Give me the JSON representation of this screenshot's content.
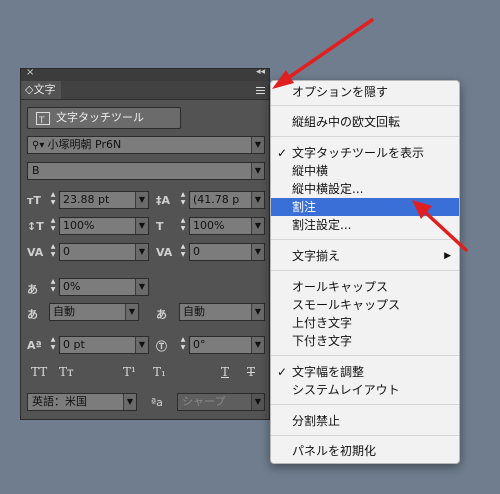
{
  "panel": {
    "tab_label": "◇文字",
    "touch_tool_label": "文字タッチツール",
    "font_family": "小塚明朝 Pr6N",
    "font_style": "B",
    "font_size": "23.88 pt",
    "leading": "(41.78 p",
    "vertical_scale": "100%",
    "horizontal_scale": "100%",
    "kerning": "0",
    "tracking": "0",
    "tsume": "0%",
    "mojigumi_before": "自動",
    "mojigumi_after": "自動",
    "baseline_shift": "0 pt",
    "rotation": "0°",
    "language": "英語：米国",
    "antialias": "シャープ",
    "tt_buttons": [
      "TT",
      "Tт",
      "T¹",
      "T₁",
      "T",
      "T"
    ]
  },
  "menu": {
    "items": [
      "オプションを隠す",
      "縦組み中の欧文回転",
      "文字タッチツールを表示",
      "縦中横",
      "縦中横設定...",
      "割注",
      "割注設定...",
      "文字揃え",
      "オールキャップス",
      "スモールキャップス",
      "上付き文字",
      "下付き文字",
      "文字幅を調整",
      "システムレイアウト",
      "分割禁止",
      "パネルを初期化"
    ],
    "checkmark": "✓",
    "submenu_arrow": "▶"
  },
  "colors": {
    "highlight": "#3a6fd8",
    "arrow": "#e02020",
    "panel_bg": "#535353"
  }
}
